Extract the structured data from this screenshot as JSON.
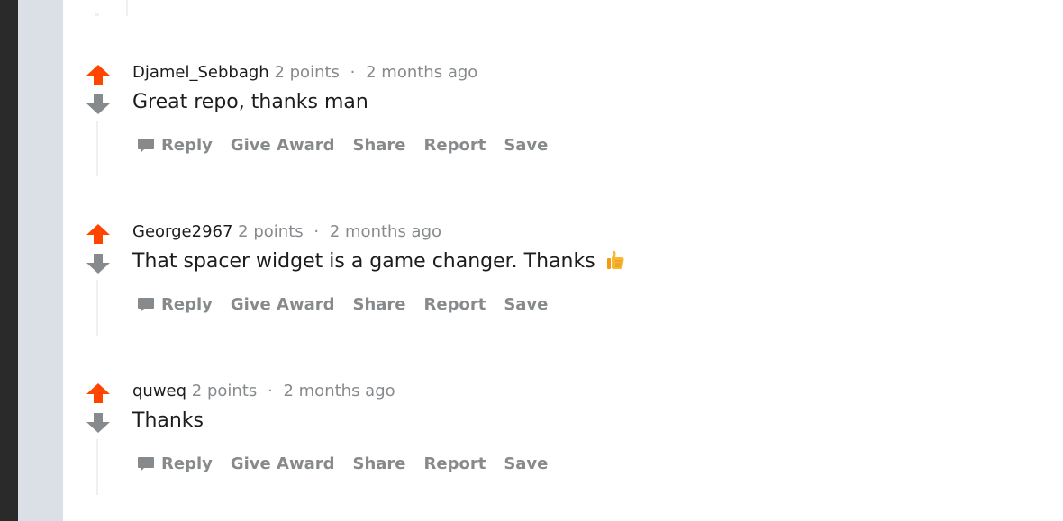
{
  "colors": {
    "upvote": "#ff4500",
    "downvote": "#878a8c",
    "meta": "#878a8c",
    "text": "#1c1c1c"
  },
  "comments": [
    {
      "author": "Djamel_Sebbagh",
      "points": "2 points",
      "separator": "·",
      "time": "2 months ago",
      "body": "Great repo, thanks man",
      "has_emoji": false
    },
    {
      "author": "George2967",
      "points": "2 points",
      "separator": "·",
      "time": "2 months ago",
      "body": "That spacer widget is a game changer. Thanks",
      "has_emoji": true,
      "emoji_icon": "thumbs-up-icon"
    },
    {
      "author": "quweq",
      "points": "2 points",
      "separator": "·",
      "time": "2 months ago",
      "body": "Thanks",
      "has_emoji": false
    }
  ],
  "actions": {
    "reply": "Reply",
    "give_award": "Give Award",
    "share": "Share",
    "report": "Report",
    "save": "Save"
  }
}
